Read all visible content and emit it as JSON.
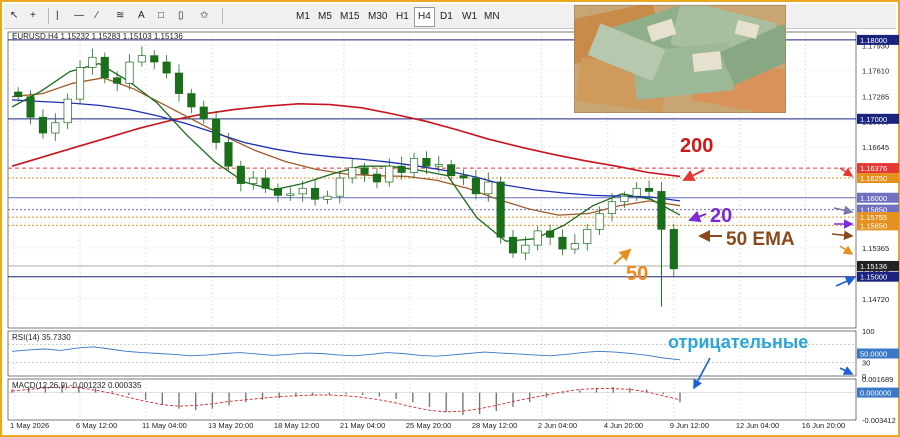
{
  "toolbar": {
    "icons": [
      "cursor-icon",
      "crosshair-icon",
      "vertical-line-icon",
      "horizontal-line-icon",
      "trendline-icon",
      "equidistant-channel-icon",
      "text-label-icon",
      "rectangle-icon",
      "object-icon",
      "shapes-icon"
    ],
    "timeframes": [
      "M1",
      "M5",
      "M15",
      "M30",
      "H1",
      "H4",
      "D1",
      "W1",
      "MN"
    ],
    "active_timeframe": "H4"
  },
  "chart_data": [
    {
      "type": "line",
      "panel": "main",
      "header": "EURUSD,H4  1.15232 1.15283 1.15103 1.15136",
      "ylim": [
        1.1435,
        1.181
      ],
      "price_ticks": [
        "1.17930",
        "1.17610",
        "1.17285",
        "1.16965",
        "1.16645",
        "1.16325",
        "1.16005",
        "1.15685",
        "1.15365",
        "1.15045",
        "1.14720"
      ],
      "x_labels": [
        "1 May 2026",
        "6 May 12:00",
        "11 May 04:00",
        "13 May 20:00",
        "18 May 12:00",
        "21 May 04:00",
        "25 May 20:00",
        "28 May 12:00",
        "2 Jun 04:00",
        "4 Jun 20:00",
        "9 Jun 12:00",
        "12 Jun 04:00",
        "16 Jun 20:00"
      ],
      "price_series_close": [
        1.1728,
        1.1702,
        1.1682,
        1.1695,
        1.1725,
        1.1765,
        1.1778,
        1.1752,
        1.1745,
        1.1772,
        1.178,
        1.1772,
        1.1758,
        1.1732,
        1.1715,
        1.17,
        1.167,
        1.164,
        1.1618,
        1.1625,
        1.1612,
        1.1603,
        1.1605,
        1.1612,
        1.1598,
        1.1602,
        1.1625,
        1.1638,
        1.163,
        1.162,
        1.164,
        1.1632,
        1.165,
        1.164,
        1.1642,
        1.1628,
        1.1625,
        1.1605,
        1.162,
        1.155,
        1.153,
        1.154,
        1.1558,
        1.155,
        1.1535,
        1.1542,
        1.156,
        1.158,
        1.1595,
        1.1602,
        1.1612,
        1.1608,
        1.156,
        1.151
      ],
      "moving_averages": [
        {
          "name": "200",
          "color": "#c8141e",
          "values": [
            1.164,
            1.1652,
            1.1664,
            1.1676,
            1.1688,
            1.1698,
            1.1706,
            1.1712,
            1.1716,
            1.1719,
            1.1718,
            1.1714,
            1.1706,
            1.1697,
            1.1686,
            1.1674,
            1.1664,
            1.1655,
            1.1647,
            1.164,
            1.1632,
            1.1627
          ]
        },
        {
          "name": "50 EMA",
          "color": "#a05a2c",
          "values": [
            1.1728,
            1.1732,
            1.1745,
            1.1752,
            1.1738,
            1.1718,
            1.1698,
            1.1678,
            1.166,
            1.1646,
            1.1636,
            1.163,
            1.1628,
            1.1627,
            1.1622,
            1.1612,
            1.1598,
            1.1586,
            1.1578,
            1.158,
            1.159,
            1.1596,
            1.159
          ]
        },
        {
          "name": "20",
          "color": "#1b6e1b",
          "values": [
            1.1715,
            1.1735,
            1.176,
            1.177,
            1.1748,
            1.172,
            1.168,
            1.1645,
            1.162,
            1.161,
            1.1618,
            1.163,
            1.164,
            1.164,
            1.1635,
            1.1628,
            1.1575,
            1.1545,
            1.1548,
            1.1565,
            1.159,
            1.1605,
            1.1598,
            1.1578
          ]
        },
        {
          "name": "blue",
          "color": "#1c2fb4",
          "values": [
            1.1724,
            1.1722,
            1.172,
            1.1717,
            1.1712,
            1.1704,
            1.1694,
            1.1682,
            1.167,
            1.1662,
            1.1656,
            1.1652,
            1.1649,
            1.1645,
            1.164,
            1.1634,
            1.1626,
            1.1616,
            1.161,
            1.1606,
            1.1603,
            1.1602,
            1.1601,
            1.1596
          ]
        }
      ],
      "horizontal_levels": [
        {
          "price": 1.18,
          "label": "1.18000",
          "style": "solid",
          "color": "#1a237e"
        },
        {
          "price": 1.17,
          "label": "1.17000",
          "style": "solid",
          "color": "#1a237e"
        },
        {
          "price": 1.16376,
          "label": "1.16376",
          "style": "dashed",
          "color": "#e53935"
        },
        {
          "price": 1.1625,
          "label": "1.16250",
          "style": "dotted",
          "color": "#e69020"
        },
        {
          "price": 1.16,
          "label": "1.16000",
          "style": "solid",
          "color": "#7070c0"
        },
        {
          "price": 1.1585,
          "label": "1.15850",
          "style": "dotted",
          "color": "#7070c0"
        },
        {
          "price": 1.15755,
          "label": "1.15755",
          "style": "dotted",
          "color": "#e69020"
        },
        {
          "price": 1.1565,
          "label": "1.15650",
          "style": "dotted",
          "color": "#e69020"
        },
        {
          "price": 1.15136,
          "label": "1.15136",
          "style": "solid",
          "color": "#aaaaaa"
        },
        {
          "price": 1.15,
          "label": "1.15000",
          "style": "solid",
          "color": "#1a237e"
        }
      ],
      "annotations": [
        "200",
        "20",
        "50 EMA",
        "50",
        "отрицательные"
      ]
    },
    {
      "type": "line",
      "panel": "rsi",
      "header": "RSI(14) 35.7330",
      "ylim": [
        0,
        100
      ],
      "ticks": [
        "100",
        "50.0000",
        "30",
        "0"
      ],
      "values": [
        55,
        58,
        60,
        57,
        62,
        65,
        60,
        55,
        52,
        50,
        48,
        45,
        47,
        50,
        52,
        49,
        46,
        48,
        51,
        50,
        47,
        45,
        48,
        52,
        50,
        46,
        44,
        47,
        50,
        53,
        51,
        49,
        47,
        45,
        48,
        52,
        55,
        53,
        50,
        46,
        40,
        36
      ]
    },
    {
      "type": "bar",
      "panel": "macd",
      "header": "MACD(12,26,9) -0.001232 0.000335",
      "ylim": [
        -0.003412,
        0.001689
      ],
      "ticks": [
        "0.001689",
        "0.000000",
        "-0.003412"
      ],
      "histogram": [
        0.0004,
        0.0006,
        0.0008,
        0.0009,
        0.0008,
        0.0005,
        0.0002,
        -0.0003,
        -0.0009,
        -0.0015,
        -0.002,
        -0.0022,
        -0.002,
        -0.0016,
        -0.0012,
        -0.0009,
        -0.0007,
        -0.0005,
        -0.0004,
        -0.0003,
        -0.0002,
        -0.0003,
        -0.0005,
        -0.0008,
        -0.0012,
        -0.0018,
        -0.0024,
        -0.0028,
        -0.0027,
        -0.0023,
        -0.0018,
        -0.0012,
        -0.0006,
        -0.0001,
        0.0003,
        0.0006,
        0.0007,
        0.0006,
        0.0004,
        -0.0002,
        -0.0012
      ],
      "signal": [
        0.0002,
        0.0004,
        0.0006,
        0.0007,
        0.0006,
        0.0003,
        -0.0001,
        -0.0006,
        -0.0011,
        -0.0015,
        -0.0017,
        -0.0016,
        -0.0014,
        -0.0011,
        -0.0009,
        -0.0007,
        -0.0005,
        -0.0004,
        -0.0003,
        -0.0003,
        -0.0004,
        -0.0006,
        -0.0009,
        -0.0013,
        -0.0018,
        -0.0022,
        -0.0024,
        -0.0023,
        -0.002,
        -0.0016,
        -0.0011,
        -0.0007,
        -0.0003,
        0.0001,
        0.0004,
        0.0005,
        0.0005,
        0.0004,
        0.0001,
        -0.0004,
        -0.0009
      ]
    }
  ],
  "colors": {
    "frame": "#e8a820",
    "grid": "#c0c0c0",
    "bull": "#1b6e1b",
    "level_blue": "#1a237e",
    "arrow_red": "#e53935",
    "arrow_orange": "#e69020",
    "arrow_purple": "#7b2cd6",
    "arrow_brown": "#8b4a1c",
    "arrow_blue": "#1c5fd6"
  }
}
